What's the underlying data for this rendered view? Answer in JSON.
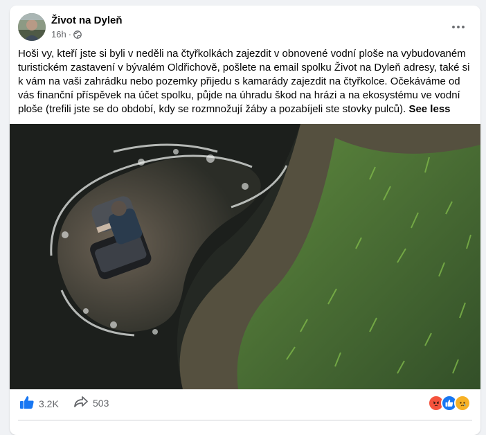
{
  "post": {
    "page_name": "Život na Dyleň",
    "time": "16h",
    "separator": "·",
    "text": "Hoši vy, kteří jste si byli v neděli na čtyřkolkách zajezdit v obnovené vodní ploše na  vybudovaném turistickém zastavení v bývalém Oldřichově, pošlete na email spolku Život na Dyleň adresy, také si k vám na vaši zahrádku nebo pozemky přijedu s kamarády zajezdit na čtyřkolce. Očekáváme od vás finanční příspěvek na účet spolku, půjde na  úhradu škod na hrázi a na ekosystému ve vodní ploše (trefili jste se do období, kdy se rozmnožují žáby a pozabíjeli ste stovky pulců).",
    "see_less_label": "See less"
  },
  "photo": {
    "alt_icon": "atv-in-water-aerial-photo"
  },
  "footer": {
    "likes": "3.2K",
    "shares": "503",
    "reactions": [
      "angry",
      "like",
      "sad"
    ]
  },
  "colors": {
    "like_blue": "#1877f2",
    "angry": "#f5533d",
    "sad": "#f7b125"
  }
}
